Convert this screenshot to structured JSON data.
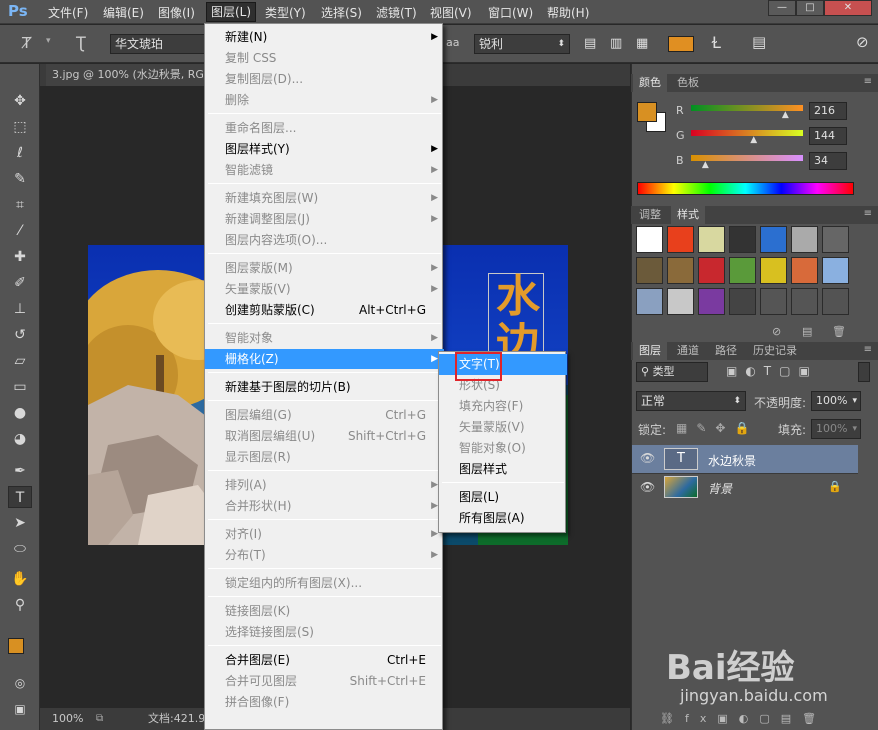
{
  "app": {
    "logo": "Ps"
  },
  "menubar": {
    "items": [
      "文件(F)",
      "编辑(E)",
      "图像(I)",
      "图层(L)",
      "类型(Y)",
      "选择(S)",
      "滤镜(T)",
      "视图(V)",
      "窗口(W)",
      "帮助(H)"
    ],
    "window_buttons": [
      "—",
      "□",
      "✕"
    ]
  },
  "options": {
    "font": "华文琥珀",
    "aa_label": "aa",
    "antialias": "锐利",
    "text_color": "#e08f22"
  },
  "document": {
    "tab_title": "3.jpg @ 100% (水边秋景, RGB/8) *",
    "overlay_text": "水边"
  },
  "status": {
    "zoom": "100%",
    "doc_info": "文档:421.9"
  },
  "color_panel": {
    "tabs": [
      "颜色",
      "色板"
    ],
    "swatch": "#d8902 2",
    "fg": "#d89022",
    "channels": [
      {
        "label": "R",
        "value": "216",
        "fraction": 0.847
      },
      {
        "label": "G",
        "value": "144",
        "fraction": 0.565
      },
      {
        "label": "B",
        "value": "34",
        "fraction": 0.133
      }
    ]
  },
  "styles_panel": {
    "tabs": [
      "调整",
      "样式"
    ]
  },
  "layers_panel": {
    "tabs": [
      "图层",
      "通道",
      "路径",
      "历史记录"
    ],
    "filter_kind": "类型",
    "blend_mode": "正常",
    "opacity_label": "不透明度:",
    "opacity": "100%",
    "lock_label": "锁定:",
    "fill_label": "填充:",
    "fill": "100%",
    "layers": [
      {
        "name": "水边秋景",
        "thumb": "T"
      },
      {
        "name": "背景"
      }
    ]
  },
  "layer_menu": {
    "items": [
      {
        "label": "新建(N)",
        "submenu": true
      },
      {
        "label": "复制 CSS",
        "disabled": true
      },
      {
        "label": "复制图层(D)...",
        "disabled": true
      },
      {
        "label": "删除",
        "disabled": true,
        "submenu": true
      },
      {
        "sep": true
      },
      {
        "label": "重命名图层...",
        "disabled": true
      },
      {
        "label": "图层样式(Y)",
        "submenu": true
      },
      {
        "label": "智能滤镜",
        "disabled": true,
        "submenu": true
      },
      {
        "sep": true
      },
      {
        "label": "新建填充图层(W)",
        "disabled": true,
        "submenu": true
      },
      {
        "label": "新建调整图层(J)",
        "disabled": true,
        "submenu": true
      },
      {
        "label": "图层内容选项(O)...",
        "disabled": true
      },
      {
        "sep": true
      },
      {
        "label": "图层蒙版(M)",
        "disabled": true,
        "submenu": true
      },
      {
        "label": "矢量蒙版(V)",
        "disabled": true,
        "submenu": true
      },
      {
        "label": "创建剪贴蒙版(C)",
        "shortcut": "Alt+Ctrl+G"
      },
      {
        "sep": true
      },
      {
        "label": "智能对象",
        "disabled": true,
        "submenu": true
      },
      {
        "label": "栅格化(Z)",
        "submenu": true,
        "highlighted": true
      },
      {
        "sep": true
      },
      {
        "label": "新建基于图层的切片(B)"
      },
      {
        "sep": true
      },
      {
        "label": "图层编组(G)",
        "disabled": true,
        "shortcut": "Ctrl+G"
      },
      {
        "label": "取消图层编组(U)",
        "disabled": true,
        "shortcut": "Shift+Ctrl+G"
      },
      {
        "label": "显示图层(R)",
        "disabled": true
      },
      {
        "sep": true
      },
      {
        "label": "排列(A)",
        "disabled": true,
        "submenu": true
      },
      {
        "label": "合并形状(H)",
        "disabled": true,
        "submenu": true
      },
      {
        "sep": true
      },
      {
        "label": "对齐(I)",
        "disabled": true,
        "submenu": true
      },
      {
        "label": "分布(T)",
        "disabled": true,
        "submenu": true
      },
      {
        "sep": true
      },
      {
        "label": "锁定组内的所有图层(X)...",
        "disabled": true
      },
      {
        "sep": true
      },
      {
        "label": "链接图层(K)",
        "disabled": true
      },
      {
        "label": "选择链接图层(S)",
        "disabled": true
      },
      {
        "sep": true
      },
      {
        "label": "合并图层(E)",
        "shortcut": "Ctrl+E"
      },
      {
        "label": "合并可见图层",
        "disabled": true,
        "shortcut": "Shift+Ctrl+E"
      },
      {
        "label": "拼合图像(F)",
        "disabled": true
      }
    ]
  },
  "rasterize_menu": {
    "items": [
      {
        "label": "文字(T)",
        "highlighted": true
      },
      {
        "label": "形状(S)",
        "disabled": true
      },
      {
        "label": "填充内容(F)",
        "disabled": true
      },
      {
        "label": "矢量蒙版(V)",
        "disabled": true
      },
      {
        "label": "智能对象(O)",
        "disabled": true
      },
      {
        "label": "图层样式"
      },
      {
        "sep": true
      },
      {
        "label": "图层(L)"
      },
      {
        "label": "所有图层(A)"
      }
    ]
  },
  "watermark": {
    "brand": "Bai经验",
    "url": "jingyan.baidu.com"
  }
}
